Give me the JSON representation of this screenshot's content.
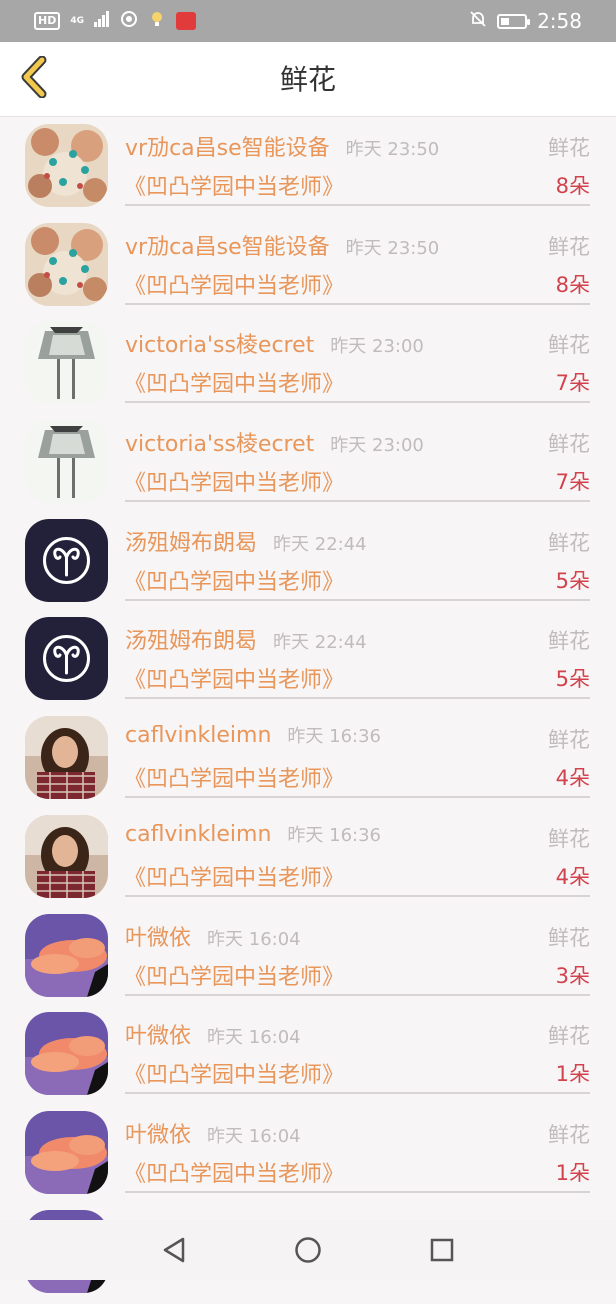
{
  "status_bar": {
    "hd": "HD",
    "network": "4G",
    "time": "2:58",
    "battery_level": 0.45
  },
  "header": {
    "title": "鲜花"
  },
  "rows": [
    {
      "name": "vr劢ca昌se智能设备",
      "time": "昨天 23:50",
      "gift": "鲜花",
      "course": "《凹凸学园中当老师》",
      "count": "8朵",
      "avatar": "food-avatar"
    },
    {
      "name": "vr劢ca昌se智能设备",
      "time": "昨天 23:50",
      "gift": "鲜花",
      "course": "《凹凸学园中当老师》",
      "count": "8朵",
      "avatar": "food-avatar"
    },
    {
      "name": "victoria'ss棱ecret",
      "time": "昨天 23:00",
      "gift": "鲜花",
      "course": "《凹凸学园中当老师》",
      "count": "7朵",
      "avatar": "sketch-avatar"
    },
    {
      "name": "victoria'ss棱ecret",
      "time": "昨天 23:00",
      "gift": "鲜花",
      "course": "《凹凸学园中当老师》",
      "count": "7朵",
      "avatar": "sketch-avatar"
    },
    {
      "name": "汤殂姆布朗曷",
      "time": "昨天 22:44",
      "gift": "鲜花",
      "course": "《凹凸学园中当老师》",
      "count": "5朵",
      "avatar": "aries-avatar"
    },
    {
      "name": "汤殂姆布朗曷",
      "time": "昨天 22:44",
      "gift": "鲜花",
      "course": "《凹凸学园中当老师》",
      "count": "5朵",
      "avatar": "aries-avatar"
    },
    {
      "name": "caflvinkleimn",
      "time": "昨天 16:36",
      "gift": "鲜花",
      "course": "《凹凸学园中当老师》",
      "count": "4朵",
      "avatar": "portrait-avatar"
    },
    {
      "name": "caflvinkleimn",
      "time": "昨天 16:36",
      "gift": "鲜花",
      "course": "《凹凸学园中当老师》",
      "count": "4朵",
      "avatar": "portrait-avatar"
    },
    {
      "name": "叶微依",
      "time": "昨天 16:04",
      "gift": "鲜花",
      "course": "《凹凸学园中当老师》",
      "count": "3朵",
      "avatar": "sky-avatar"
    },
    {
      "name": "叶微依",
      "time": "昨天 16:04",
      "gift": "鲜花",
      "course": "《凹凸学园中当老师》",
      "count": "1朵",
      "avatar": "sky-avatar"
    },
    {
      "name": "叶微依",
      "time": "昨天 16:04",
      "gift": "鲜花",
      "course": "《凹凸学园中当老师》",
      "count": "1朵",
      "avatar": "sky-avatar"
    }
  ],
  "colors": {
    "accent_orange": "#e8965a",
    "count_red": "#d2424c",
    "muted_gray": "#c0bcbd",
    "back_arrow": "#f2c94c"
  }
}
